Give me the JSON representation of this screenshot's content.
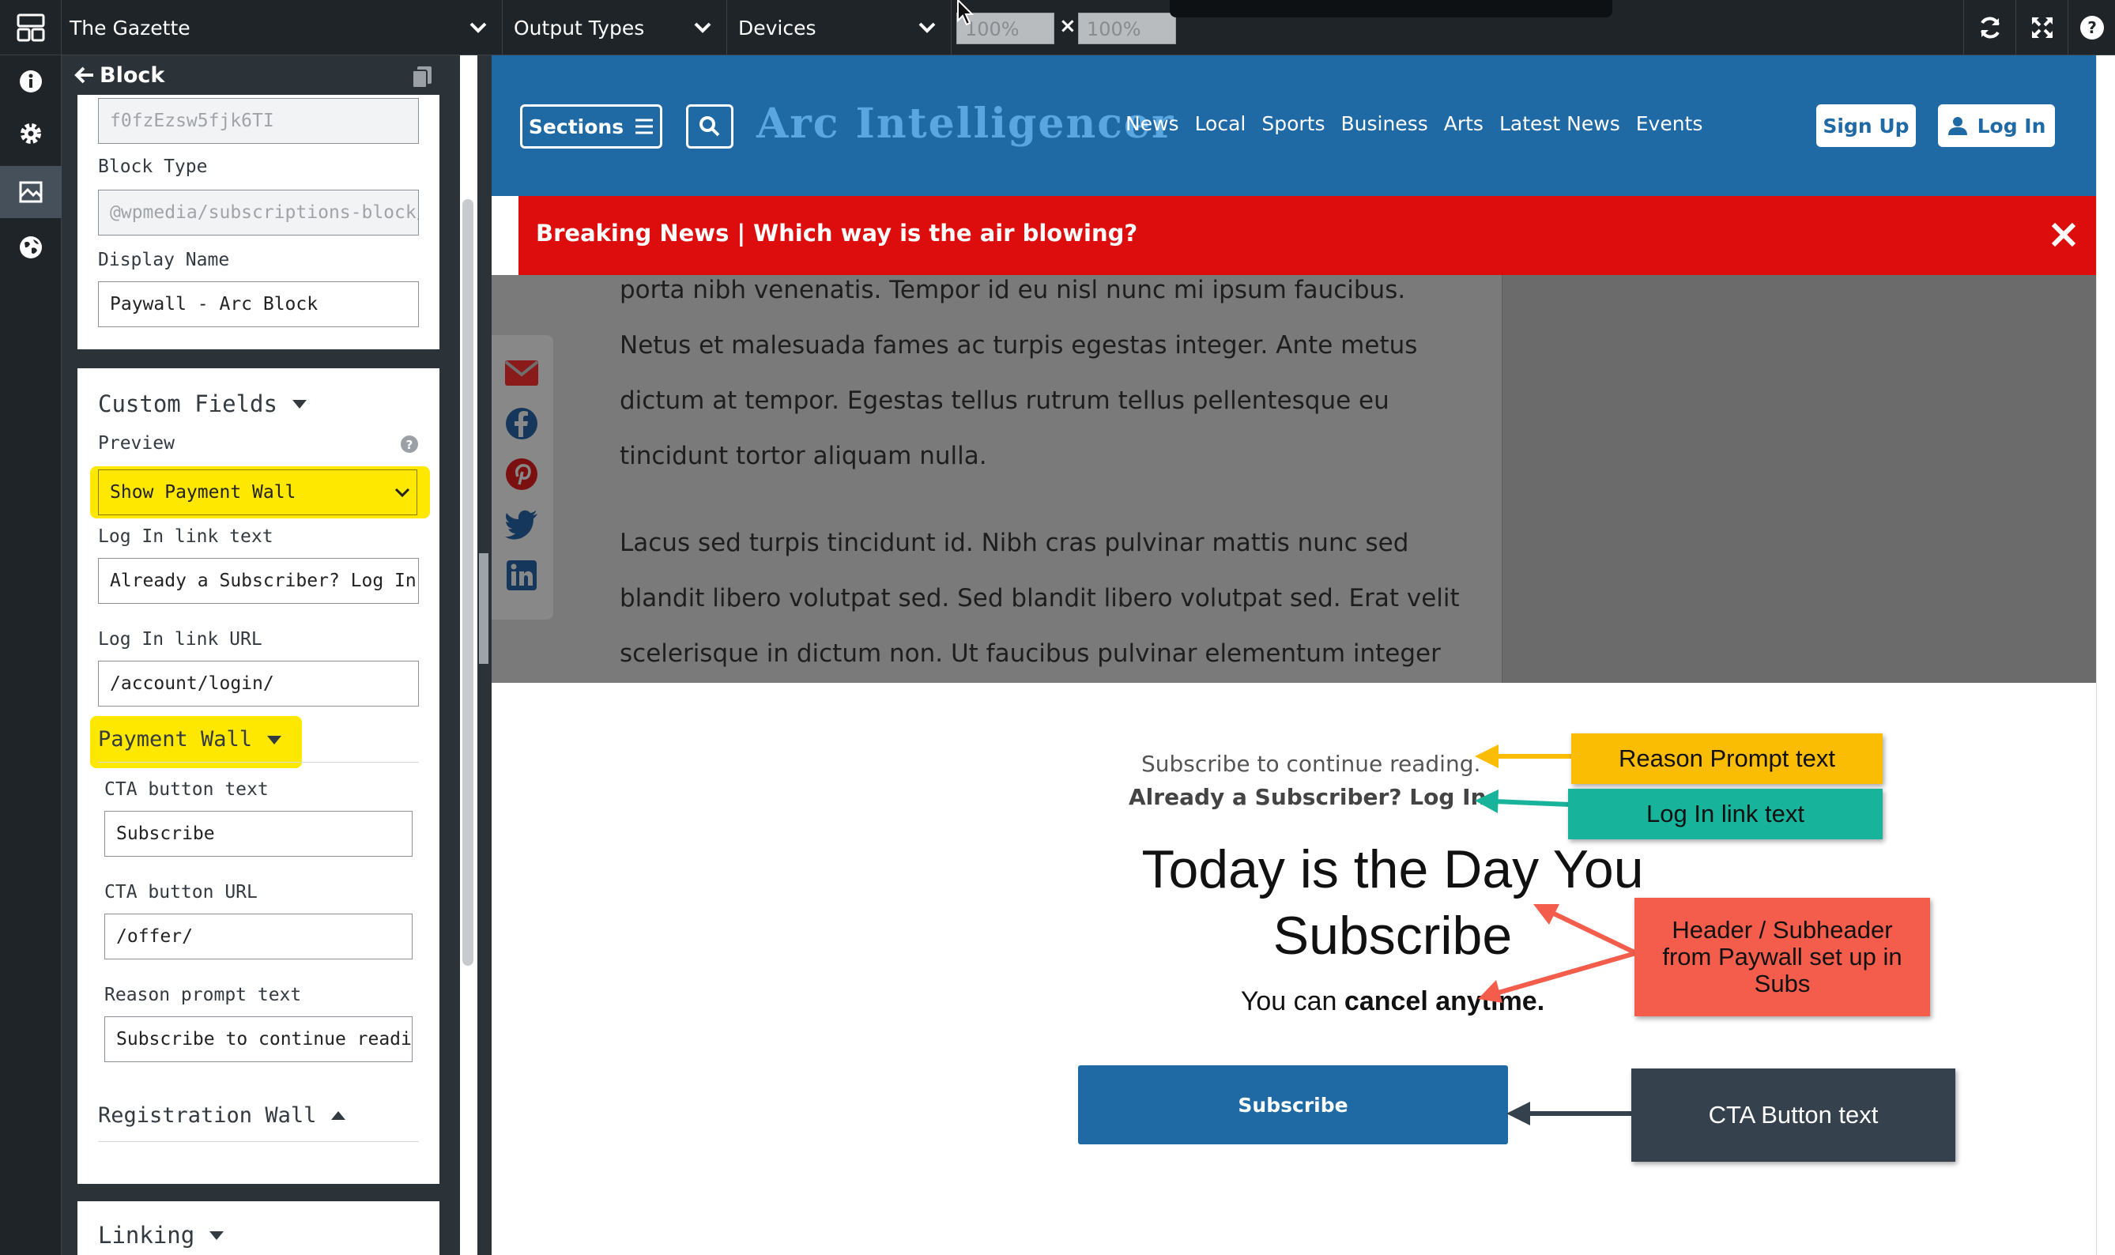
{
  "topbar": {
    "site": "The Gazette",
    "output_types": "Output Types",
    "devices": "Devices",
    "zoom_width": "100%",
    "zoom_x": "×",
    "zoom_height": "100%"
  },
  "panel": {
    "back_label": "Block",
    "block_id": "f0fzEzsw5fjk6TI",
    "block_type_label": "Block Type",
    "block_type_value": "@wpmedia/subscriptions-block/p",
    "display_name_label": "Display Name",
    "display_name_value": "Paywall - Arc Block",
    "custom_fields_title": "Custom Fields",
    "preview_label": "Preview",
    "preview_value": "Show Payment Wall",
    "login_text_label": "Log In link text",
    "login_text_value": "Already a Subscriber? Log In.",
    "login_url_label": "Log In link URL",
    "login_url_value": "/account/login/",
    "payment_wall_title": "Payment Wall",
    "cta_text_label": "CTA button text",
    "cta_text_value": "Subscribe",
    "cta_url_label": "CTA button URL",
    "cta_url_value": "/offer/",
    "reason_label": "Reason prompt text",
    "reason_value": "Subscribe to continue reading.",
    "registration_wall_title": "Registration Wall",
    "linking_title": "Linking"
  },
  "site": {
    "sections_label": "Sections",
    "logo": "Arc Intelligencer",
    "nav": [
      "News",
      "Local",
      "Sports",
      "Business",
      "Arts",
      "Latest News",
      "Events"
    ],
    "signup_label": "Sign Up",
    "login_label": "Log In",
    "breaking_text": "Breaking News | Which way is the air blowing?",
    "paragraph1": [
      "porta nibh venenatis. Tempor id eu nisl nunc mi ipsum faucibus.",
      "Netus et malesuada fames ac turpis egestas integer. Ante metus",
      "dictum at tempor. Egestas tellus rutrum tellus pellentesque eu",
      "tincidunt tortor aliquam nulla."
    ],
    "paragraph2": [
      "Lacus sed turpis tincidunt id. Nibh cras pulvinar mattis nunc sed",
      "blandit libero volutpat sed. Sed blandit libero volutpat sed. Erat velit",
      "scelerisque in dictum non. Ut faucibus pulvinar elementum integer"
    ]
  },
  "paywall": {
    "reason": "Subscribe to continue reading.",
    "login": "Already a Subscriber? Log In.",
    "title_line1": "Today is the Day You",
    "title_line2": "Subscribe",
    "sub_prefix": "You can ",
    "sub_bold": "cancel anytime.",
    "cta": "Subscribe"
  },
  "annotations": {
    "reason": "Reason Prompt text",
    "login": "Log In link text",
    "header_line1": "Header / Subheader",
    "header_line2": "from Paywall set up in",
    "header_line3": "Subs",
    "cta": "CTA Button text"
  },
  "colors": {
    "brand_blue": "#1f6aa5",
    "breaking_red": "#dd0d0d",
    "highlight_yellow": "#ffe800",
    "anno_yellow": "#fbbc04",
    "anno_teal": "#17b39a",
    "anno_red": "#f45d4c",
    "anno_dark": "#35424d"
  }
}
